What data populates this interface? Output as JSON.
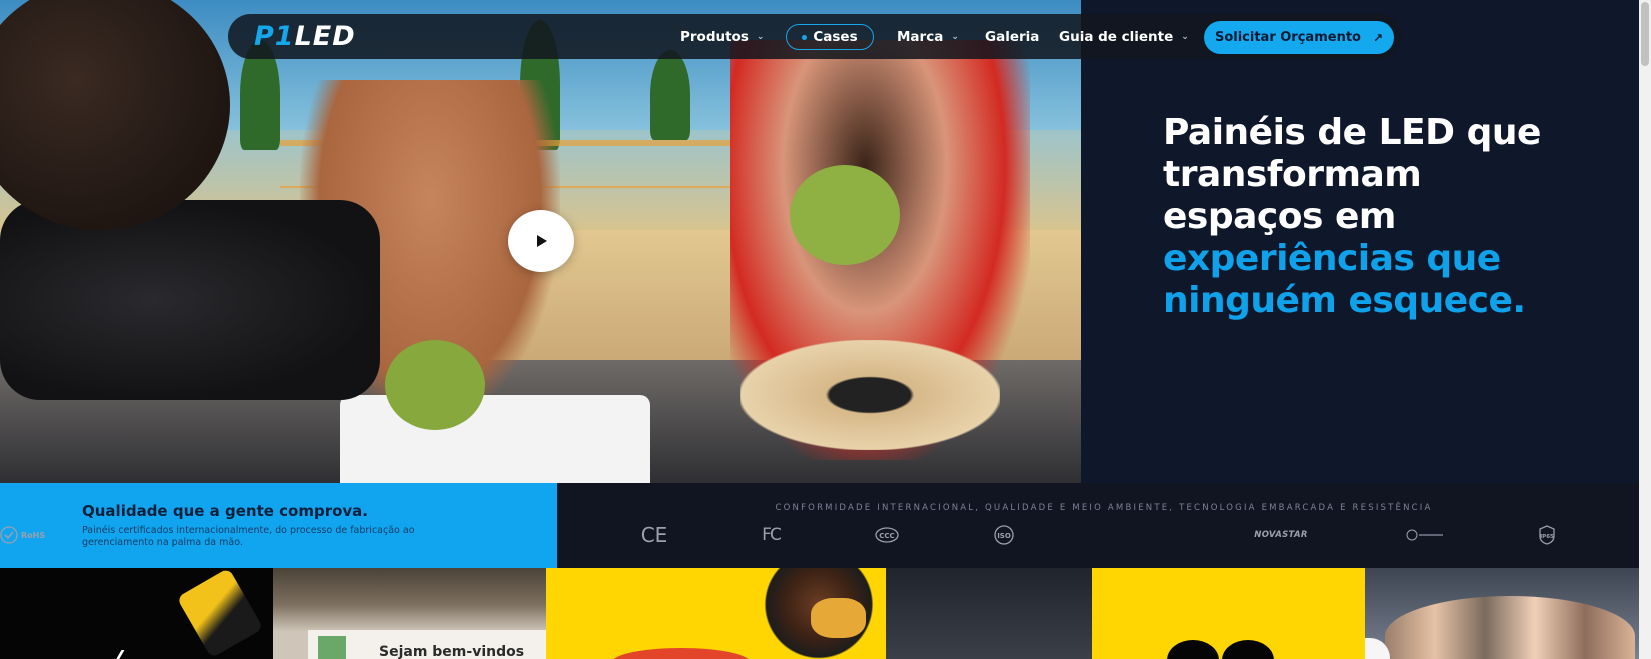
{
  "brand": {
    "logo_prefix": "P1",
    "logo_suffix": "LED",
    "accent_color": "#15a7ec",
    "dark_color": "#0f172b"
  },
  "nav": {
    "items": [
      {
        "label": "Produtos",
        "has_dropdown": true
      },
      {
        "label": "Cases",
        "active": true
      },
      {
        "label": "Marca",
        "has_dropdown": true
      },
      {
        "label": "Galeria",
        "has_dropdown": false
      },
      {
        "label": "Guia de cliente",
        "has_dropdown": true
      }
    ],
    "cta_label": "Solicitar Orçamento",
    "cta_icon": "arrow-up-right-icon",
    "chevron_glyph": "⌄",
    "arrow_glyph": "↗"
  },
  "hero": {
    "heading_lines": [
      "Painéis de LED que",
      "transformam",
      "espaços em"
    ],
    "heading_accent_lines": [
      "experiências que",
      "ninguém esquece."
    ],
    "play_icon": "play-icon"
  },
  "quality": {
    "title": "Qualidade que a gente comprova.",
    "text": "Painéis certificados internacionalmente, do processo de fabricação ao gerenciamento na palma da mão."
  },
  "certifications": {
    "caption": "CONFORMIDADE INTERNACIONAL, QUALIDADE E MEIO AMBIENTE, TECNOLOGIA EMBARCADA E RESISTÊNCIA",
    "logos": [
      {
        "name": "ce-logo",
        "label": "CE"
      },
      {
        "name": "fcc-logo",
        "label": "FC"
      },
      {
        "name": "ccc-logo",
        "label": "CCC"
      },
      {
        "name": "iso-logo",
        "label": "ISO"
      },
      {
        "name": "rohs-logo",
        "label": "RoHS"
      },
      {
        "name": "novastar-logo",
        "label": "NOVASTAR"
      },
      {
        "name": "certification-badge-logo",
        "label": ""
      },
      {
        "name": "ip65-logo",
        "label": "IP65"
      }
    ]
  },
  "tiles": {
    "welcome_text": "Sejam bem-vindos"
  }
}
